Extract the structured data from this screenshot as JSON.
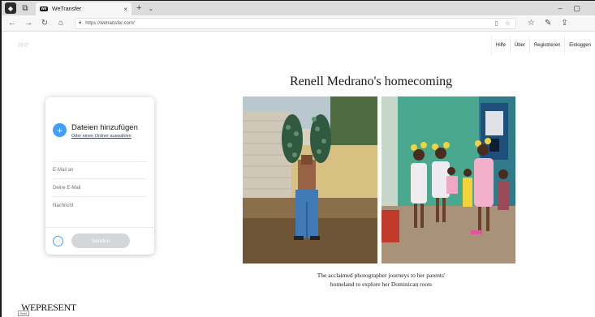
{
  "browser": {
    "tab_title": "WeTransfer",
    "tab_close": "×",
    "new_tab": "+",
    "tab_menu": "⌄",
    "url": "https://wetransfer.com/",
    "window_controls": [
      "–",
      "▢"
    ]
  },
  "site": {
    "logo": "we",
    "nav": [
      "Hilfe",
      "Über",
      "Registrieren",
      "Einloggen"
    ]
  },
  "feature": {
    "headline": "Renell Medrano's homecoming",
    "caption_line1": "The acclaimed photographer journeys to her parents'",
    "caption_line2": "homeland to explore her Dominican roots"
  },
  "footer": {
    "brand": "WEPRESENT",
    "brand_sub": "Read"
  },
  "upload": {
    "add_files": "Dateien hinzufügen",
    "add_folder": "Oder einen Ordner auswählen",
    "email_to": "E-Mail an",
    "your_email": "Deine E-Mail",
    "message": "Nachricht",
    "more_options": "···",
    "send": "Senden"
  },
  "colors": {
    "accent": "#409fff",
    "send_disabled": "#d4d7d9"
  }
}
